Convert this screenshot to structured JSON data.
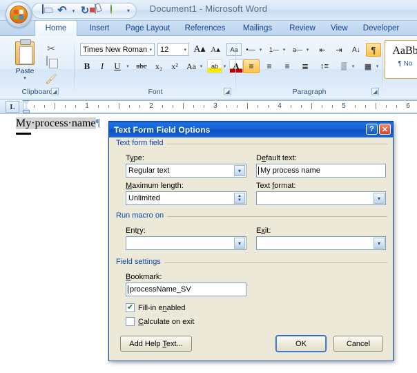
{
  "window": {
    "title": "Document1 - Microsoft Word",
    "office_orb": "office-orb"
  },
  "quick_access": {
    "items": [
      {
        "name": "save-icon",
        "label": "Save"
      },
      {
        "name": "undo-icon",
        "label": "Undo"
      },
      {
        "name": "undo-dropdown-arrow",
        "label": "▾"
      },
      {
        "name": "redo-icon",
        "label": "Redo"
      },
      {
        "name": "print-preview-icon",
        "label": "Print Preview"
      },
      {
        "name": "green-status-icon",
        "label": "Status"
      }
    ],
    "customize_arrow": "▾"
  },
  "ribbon": {
    "tabs": [
      {
        "label": "Home",
        "active": true
      },
      {
        "label": "Insert",
        "active": false
      },
      {
        "label": "Page Layout",
        "active": false
      },
      {
        "label": "References",
        "active": false
      },
      {
        "label": "Mailings",
        "active": false
      },
      {
        "label": "Review",
        "active": false
      },
      {
        "label": "View",
        "active": false
      },
      {
        "label": "Developer",
        "active": false
      }
    ],
    "groups": [
      {
        "label": "Clipboard"
      },
      {
        "label": "Font"
      },
      {
        "label": "Paragraph"
      }
    ],
    "clipboard": {
      "paste_label": "Paste",
      "paste_caret": "▾",
      "cut_icon": "✂",
      "copy_icon": "copy",
      "format_painter_icon": "✒"
    },
    "font": {
      "font_name": "Times New Roman",
      "font_size": "12",
      "grow_font": "A",
      "shrink_font": "A",
      "clear_formatting": "Aa",
      "bold": "B",
      "italic": "I",
      "underline": "U",
      "strikethrough": "abc",
      "subscript": "x₂",
      "superscript": "x²",
      "change_case": "Aa",
      "highlight": "ab",
      "font_color": "A",
      "arrow": "▾"
    },
    "paragraph": {
      "bullets": "•–",
      "numbering": "1–",
      "multilevel": "a–",
      "decrease_indent": "←≡",
      "increase_indent": "≡→",
      "sort": "A↓",
      "show_marks": "¶",
      "align_left": "≡",
      "align_center": "≡",
      "align_right": "≡",
      "justify": "≡",
      "line_spacing": "↕≡",
      "shading": "▒",
      "borders": "▦",
      "arrow": "▾"
    },
    "styles": {
      "sample": "AaBb",
      "style_name": "¶ No"
    }
  },
  "ruler": {
    "tab_stop_type": "L",
    "numbers": [
      "1",
      "2",
      "3",
      "4",
      "5",
      "6"
    ]
  },
  "document": {
    "field_text": "My·process·name",
    "paragraph_mark": "¶"
  },
  "dialog": {
    "title": "Text Form Field Options",
    "help_button": "?",
    "close_button": "✕",
    "groups": {
      "text_form_field": {
        "title": "Text form field",
        "type_label": "Type:",
        "type_value": "Regular text",
        "default_text_label": "Default text:",
        "default_text_value": "My process name",
        "maximum_length_label": "Maximum length:",
        "maximum_length_value": "Unlimited",
        "text_format_label": "Text format:",
        "text_format_value": ""
      },
      "run_macro_on": {
        "title": "Run macro on",
        "entry_label": "Entry:",
        "entry_value": "",
        "exit_label": "Exit:",
        "exit_value": ""
      },
      "field_settings": {
        "title": "Field settings",
        "bookmark_label": "Bookmark:",
        "bookmark_value": "processName_SV",
        "fill_in_enabled_label": "Fill-in enabled",
        "fill_in_enabled_checked": true,
        "calculate_on_exit_label": "Calculate on exit",
        "calculate_on_exit_checked": false
      }
    },
    "buttons": {
      "add_help_text": "Add Help Text...",
      "ok": "OK",
      "cancel": "Cancel"
    },
    "dropdown_arrow": "▾",
    "spin_up": "▲",
    "spin_down": "▼"
  },
  "colors": {
    "dialog_titlebar": "#0b5fd4",
    "dialog_face": "#ece9d8",
    "group_title": "#0a46a8",
    "ribbon_tab_text": "#15428b",
    "field_shading": "#d4d4d4",
    "accent_orange": "#e0a33c"
  }
}
